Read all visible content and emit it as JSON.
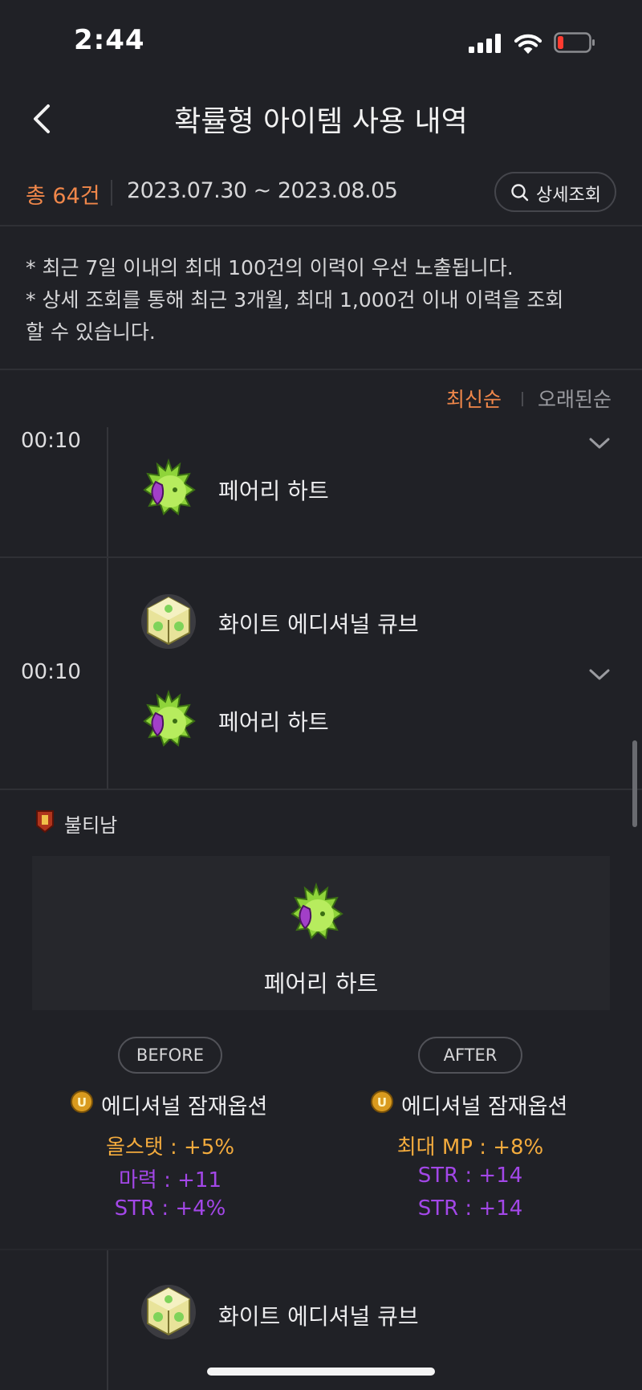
{
  "status_bar": {
    "time": "2:44"
  },
  "header": {
    "title": "확률형 아이템 사용 내역"
  },
  "summary": {
    "count": "총 64건",
    "date_range": "2023.07.30 ~ 2023.08.05",
    "detail_search_label": "상세조회"
  },
  "notice": {
    "line1": "* 최근 7일 이내의 최대 100건의 이력이 우선 노출됩니다.",
    "line2": "* 상세 조회를 통해 최근 3개월, 최대 1,000건 이내 이력을 조회",
    "line3": "할 수 있습니다."
  },
  "sort": {
    "newest": "최신순",
    "oldest": "오래된순",
    "active": "newest"
  },
  "entries": [
    {
      "time": "00:10",
      "items": [
        {
          "name": "페어리 하트",
          "icon": "fairy-heart-icon"
        }
      ]
    },
    {
      "time": "00:10",
      "items": [
        {
          "name": "화이트 에디셔널 큐브",
          "icon": "white-additional-cube-icon"
        },
        {
          "name": "페어리 하트",
          "icon": "fairy-heart-icon"
        }
      ]
    },
    {
      "time": "",
      "items": [
        {
          "name": "화이트 에디셔널 큐브",
          "icon": "white-additional-cube-icon"
        }
      ]
    }
  ],
  "expanded_detail": {
    "character": "불티남",
    "item_name": "페어리 하트",
    "before": {
      "label": "BEFORE",
      "option_type": "에디셔널 잠재옵션",
      "options": [
        {
          "text": "올스탯 : +5%",
          "grade": "legendary"
        },
        {
          "text": "마력 : +11",
          "grade": "epic"
        },
        {
          "text": "STR : +4%",
          "grade": "epic"
        }
      ]
    },
    "after": {
      "label": "AFTER",
      "option_type": "에디셔널 잠재옵션",
      "options": [
        {
          "text": "최대 MP : +8%",
          "grade": "legendary"
        },
        {
          "text": "STR : +14",
          "grade": "epic"
        },
        {
          "text": "STR : +14",
          "grade": "epic"
        }
      ]
    }
  },
  "colors": {
    "background": "#202126",
    "accent_orange": "#f0874a",
    "legendary": "#f3ab3d",
    "epic": "#a347e8"
  }
}
